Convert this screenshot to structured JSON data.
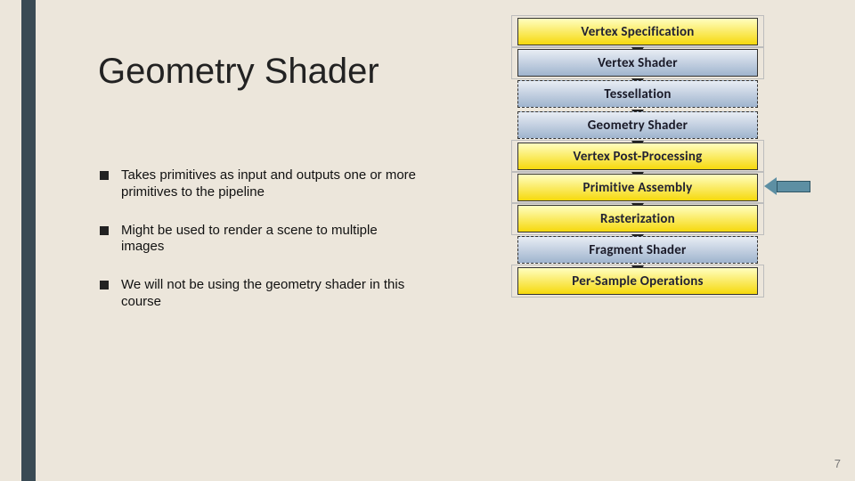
{
  "title": "Geometry Shader",
  "bullets": [
    "Takes primitives as input and outputs one or more primitives to the pipeline",
    "Might be used to render a scene to multiple images",
    "We will not be using the geometry shader in this course"
  ],
  "pipeline": [
    {
      "label": "Vertex Specification",
      "style": "yel",
      "dashed": false,
      "outer": true
    },
    {
      "label": "Vertex Shader",
      "style": "blu",
      "dashed": false,
      "outer": true
    },
    {
      "label": "Tessellation",
      "style": "blu",
      "dashed": true,
      "outer": false
    },
    {
      "label": "Geometry Shader",
      "style": "blu",
      "dashed": true,
      "outer": false
    },
    {
      "label": "Vertex Post-Processing",
      "style": "yel",
      "dashed": false,
      "outer": true
    },
    {
      "label": "Primitive Assembly",
      "style": "yel",
      "dashed": false,
      "outer": true
    },
    {
      "label": "Rasterization",
      "style": "yel",
      "dashed": false,
      "outer": true
    },
    {
      "label": "Fragment Shader",
      "style": "blu",
      "dashed": true,
      "outer": false
    },
    {
      "label": "Per-Sample Operations",
      "style": "yel",
      "dashed": false,
      "outer": true
    }
  ],
  "pointer_target_index": 3,
  "page_number": "7"
}
